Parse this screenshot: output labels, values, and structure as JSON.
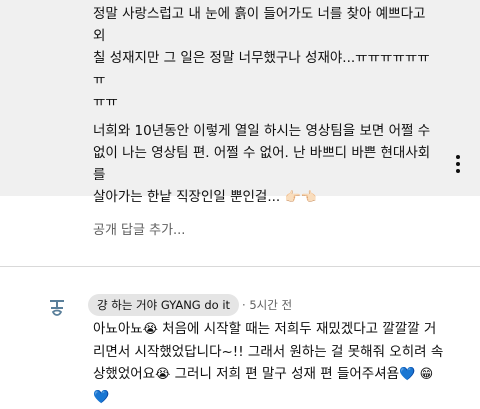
{
  "top_comment": {
    "paragraph1_line1": "정말 사랑스럽고 내 눈에 흙이 들어가도 너를 찾아 예쁘다고 외",
    "paragraph1_line2": "칠 성재지만 그 일은 정말 너무했구나 성재야...ㅠㅠㅠㅠㅠㅠㅠ",
    "paragraph1_line3": "ㅠㅠ",
    "paragraph2_line1": "너희와 10년동안 이렇게 열일 하시는 영상팀을 보면 어쩔 수",
    "paragraph2_line2": "없이 나는 영상팀 편. 어쩔 수 없어. 난 바쁘디 바쁜 현대사회를",
    "paragraph2_line3": "살아가는 한낱 직장인일 뿐인걸...",
    "paragraph2_emoji": "👉🏻👈🏻"
  },
  "reply_box": {
    "placeholder": "공개 답글 추가..."
  },
  "reply": {
    "author": "걍 하는 거야 GYANG do it",
    "separator": "·",
    "time": "5시간 전",
    "line1a": "아뇨아뇨",
    "emoji_sad": "😭",
    "line1b": " 처음에 시작할 때는 저희두 재밌겠다고 깔깔깔 거",
    "line2": "리면서 시작했었답니다~!! 그래서 원하는 걸 못해줘 오히려 속",
    "line3a": "상했었어요",
    "line3b": " 그러니 저희 편 말구 성재 편 들어주셔욤",
    "heart": "💙",
    "emoji_smile": "😁"
  },
  "colors": {
    "top_background": "#f0f0f0",
    "chip_background": "#e5e5e5",
    "secondary_text": "#606060",
    "divider": "#d9d9d9"
  },
  "icons": {
    "more": "kebab-vertical-icon",
    "avatar": "channel-avatar-icon"
  }
}
